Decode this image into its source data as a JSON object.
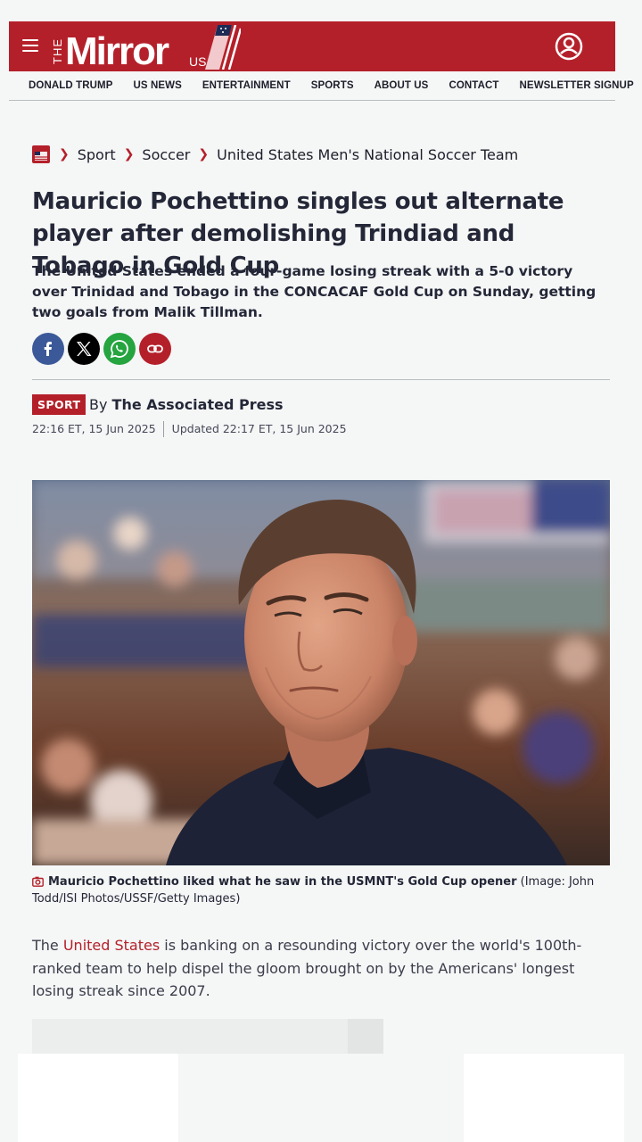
{
  "header": {
    "logo_the": "THE",
    "logo_word": "Mirror",
    "logo_us": "US",
    "brand_color": "#b4202a"
  },
  "nav": {
    "items": [
      "DONALD TRUMP",
      "US NEWS",
      "ENTERTAINMENT",
      "SPORTS",
      "ABOUT US",
      "CONTACT",
      "NEWSLETTER SIGNUP"
    ]
  },
  "breadcrumb": {
    "items": [
      "Sport",
      "Soccer",
      "United States Men's National Soccer Team"
    ]
  },
  "article": {
    "headline": "Mauricio Pochettino singles out alternate player after demolishing Trindiad and Tobago in Gold Cup",
    "standfirst": "The United States ended a four-game losing streak with a 5-0 victory over Trinidad and Tobago in the CONCACAF Gold Cup on Sunday, getting two goals from Malik Tillman.",
    "tag": "SPORT",
    "by": "By",
    "author": "The Associated Press",
    "published": "22:16 ET, 15 Jun 2025",
    "updated": "Updated 22:17 ET, 15 Jun 2025",
    "caption_bold": "Mauricio Pochettino liked what he saw in the USMNT's Gold Cup opener",
    "caption_credit": "(Image: John Todd/ISI Photos/USSF/Getty Images)",
    "body_pre": "The ",
    "body_link": "United States",
    "body_post": " is banking on a resounding victory over the world's 100th-ranked team to help dispel the gloom brought on by the Americans' longest losing streak since 2007."
  },
  "share": {
    "icons": [
      "facebook-icon",
      "x-icon",
      "whatsapp-icon",
      "link-icon"
    ]
  }
}
